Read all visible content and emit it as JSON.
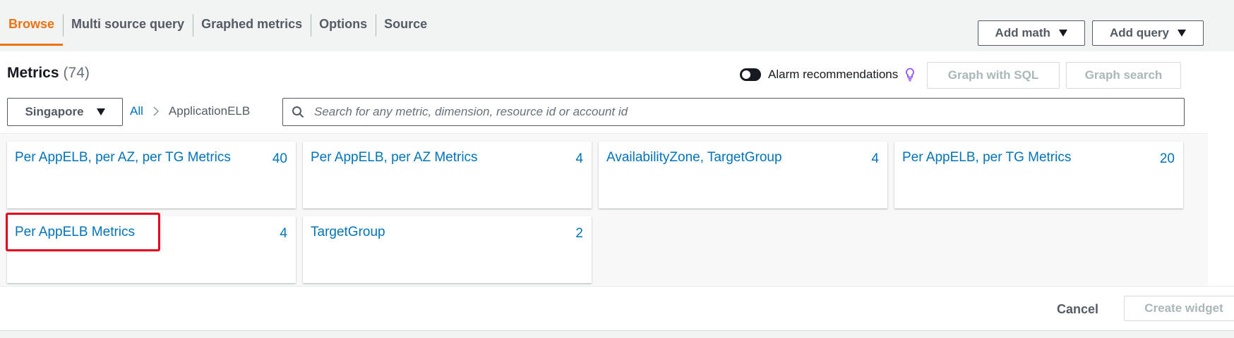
{
  "tabs": [
    {
      "label": "Browse"
    },
    {
      "label": "Multi source query"
    },
    {
      "label": "Graphed metrics"
    },
    {
      "label": "Options"
    },
    {
      "label": "Source"
    }
  ],
  "actions": {
    "add_math": "Add math",
    "add_query": "Add query"
  },
  "metrics": {
    "title": "Metrics",
    "count": "(74)",
    "alarm_recommendations": "Alarm recommendations",
    "graph_with_sql": "Graph with SQL",
    "graph_search": "Graph search"
  },
  "region": {
    "selected": "Singapore"
  },
  "breadcrumb": {
    "all": "All",
    "current": "ApplicationELB"
  },
  "search": {
    "placeholder": "Search for any metric, dimension, resource id or account id"
  },
  "cards": [
    {
      "title": "Per AppELB, per AZ, per TG Metrics",
      "count": "40"
    },
    {
      "title": "Per AppELB, per AZ Metrics",
      "count": "4"
    },
    {
      "title": "AvailabilityZone, TargetGroup",
      "count": "4"
    },
    {
      "title": "Per AppELB, per TG Metrics",
      "count": "20"
    },
    {
      "title": "Per AppELB Metrics",
      "count": "4"
    },
    {
      "title": "TargetGroup",
      "count": "2"
    }
  ],
  "footer": {
    "cancel": "Cancel",
    "create_widget": "Create widget"
  },
  "colors": {
    "accent": "#ec7211",
    "link": "#0073bb",
    "highlight": "#e0001b"
  }
}
